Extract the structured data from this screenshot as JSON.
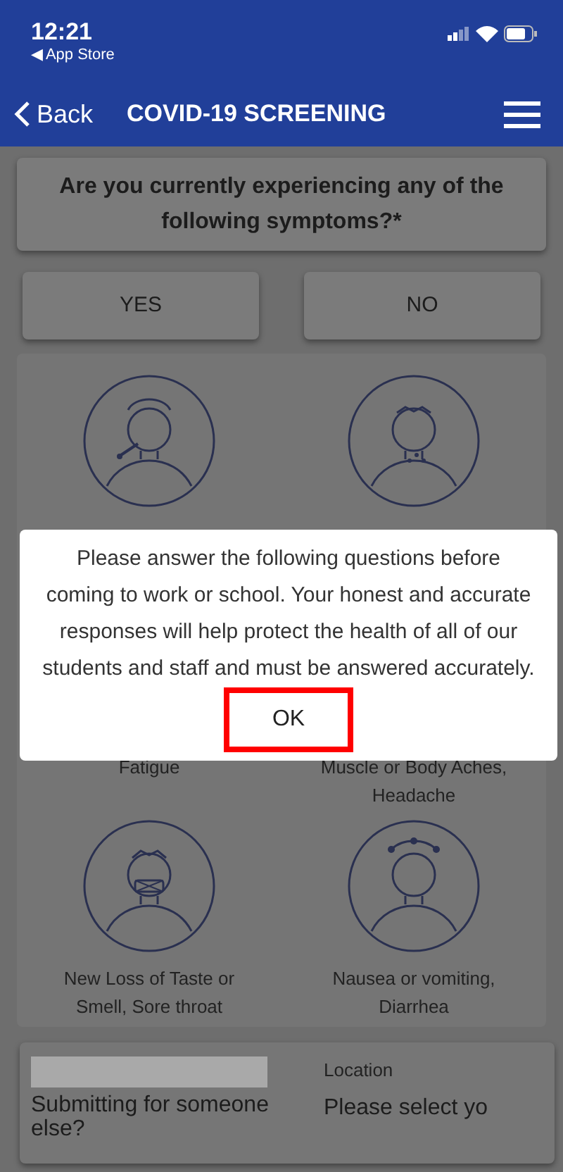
{
  "status_bar": {
    "time": "12:21",
    "back_app": "◀ App Store"
  },
  "nav": {
    "back": "Back",
    "title": "COVID-19 SCREENING"
  },
  "question": "Are you currently experiencing any of the following symptoms?*",
  "answers": [
    {
      "label": "YES"
    },
    {
      "label": "NO"
    }
  ],
  "symptoms": [
    {
      "kind": "fever"
    },
    {
      "kind": "cough"
    },
    {
      "kind": "text",
      "label": "Fatigue"
    },
    {
      "kind": "text",
      "label": "Muscle or Body Aches, Headache"
    },
    {
      "kind": "taste",
      "label": "New Loss of Taste or Smell, Sore throat"
    },
    {
      "kind": "dizzy",
      "label": "Nausea or vomiting, Diarrhea"
    }
  ],
  "dialog": {
    "message": "Please answer the following questions before coming to work or school. Your honest and accurate responses will help protect the health of all of our students and staff and must be answered accurately.",
    "ok": "OK",
    "ok_highlighted": true
  },
  "footer": {
    "someone_label": "Submitting for someone else?",
    "location_label": "Location",
    "location_value": "Please select yo"
  }
}
